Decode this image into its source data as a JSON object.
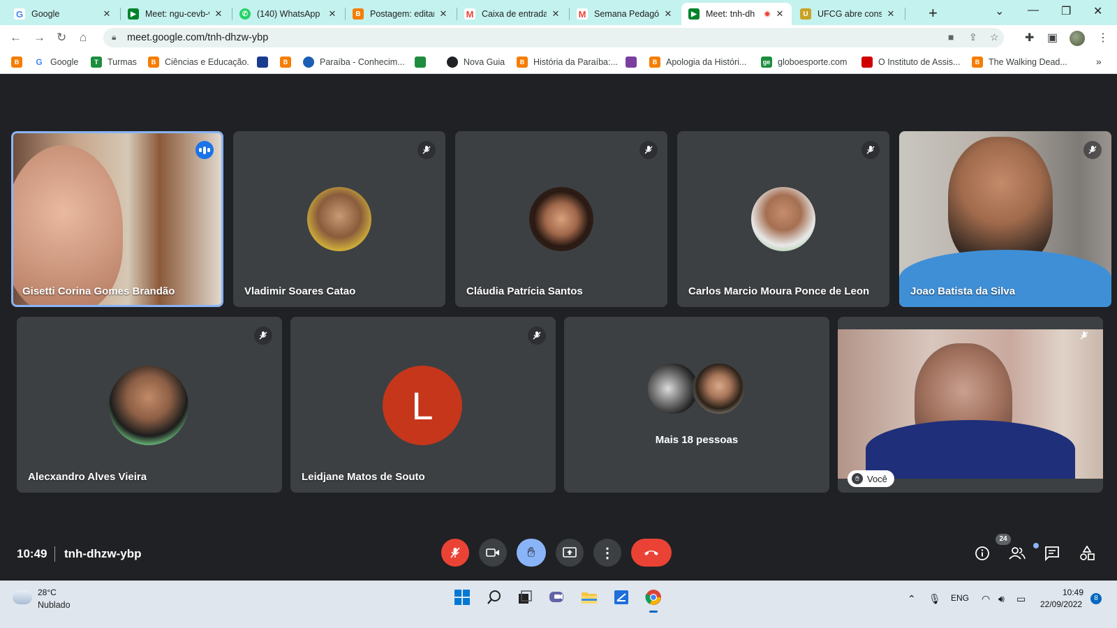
{
  "browser": {
    "tabs": [
      {
        "title": "Google",
        "favicon": "google-icon",
        "color": "#4285f4",
        "glyph": "G"
      },
      {
        "title": "Meet: ngu-cevb-v",
        "favicon": "meet-icon",
        "color": "#00832d",
        "glyph": "▶"
      },
      {
        "title": "(140) WhatsApp",
        "favicon": "whatsapp-icon",
        "color": "#25d366",
        "glyph": "✆"
      },
      {
        "title": "Postagem: editar",
        "favicon": "blogger-icon",
        "color": "#f57d00",
        "glyph": "B"
      },
      {
        "title": "Caixa de entrada",
        "favicon": "gmail-icon",
        "color": "#ea4335",
        "glyph": "M"
      },
      {
        "title": "Semana Pedagóg",
        "favicon": "gmail-icon",
        "color": "#ea4335",
        "glyph": "M"
      },
      {
        "title": "Meet: tnh-dh",
        "favicon": "meet-icon",
        "color": "#00832d",
        "glyph": "▶",
        "active": true,
        "recording": true
      },
      {
        "title": "UFCG abre consu",
        "favicon": "ufcg-icon",
        "color": "#c9a227",
        "glyph": "U"
      }
    ],
    "new_tab": "+",
    "url": "meet.google.com/tnh-dhzw-ybp",
    "bookmarks": [
      {
        "label": "",
        "icon": "blogger-icon",
        "color": "#f57d00",
        "glyph": "B"
      },
      {
        "label": "Google",
        "icon": "google-icon",
        "color": "#4285f4",
        "glyph": "G"
      },
      {
        "label": "Turmas",
        "icon": "classroom-icon",
        "color": "#1e8e3e",
        "glyph": "T"
      },
      {
        "label": "Ciências e Educação.",
        "icon": "blogger-icon",
        "color": "#f57d00",
        "glyph": "B"
      },
      {
        "label": "",
        "icon": "site-icon",
        "color": "#1a3c8f",
        "glyph": "▬"
      },
      {
        "label": "",
        "icon": "blogger-icon",
        "color": "#f57d00",
        "glyph": "B"
      },
      {
        "label": "Paraíba - Conhecim...",
        "icon": "brain-icon",
        "color": "#1a5fb4",
        "glyph": "◉"
      },
      {
        "label": "",
        "icon": "flag-icon",
        "color": "#1e8e3e",
        "glyph": "◆"
      },
      {
        "label": "Nova Guia",
        "icon": "globe-icon",
        "color": "#202124",
        "glyph": "◍"
      },
      {
        "label": "História da Paraíba:...",
        "icon": "blogger-icon",
        "color": "#f57d00",
        "glyph": "B"
      },
      {
        "label": "",
        "icon": "site-icon",
        "color": "#7b3fa0",
        "glyph": "▦"
      },
      {
        "label": "Apologia da Históri...",
        "icon": "blogger-icon",
        "color": "#f57d00",
        "glyph": "B"
      },
      {
        "label": "globoesporte.com",
        "icon": "ge-icon",
        "color": "#1e8e3e",
        "glyph": "ge"
      },
      {
        "label": "O Instituto de Assis...",
        "icon": "flag-icon",
        "color": "#d10000",
        "glyph": "■"
      },
      {
        "label": "The Walking Dead...",
        "icon": "blogger-icon",
        "color": "#f57d00",
        "glyph": "B"
      }
    ],
    "more_bookmarks": "»"
  },
  "meet": {
    "participants": [
      {
        "name": "Gisetti Corina Gomes Brandão",
        "kind": "video",
        "speaking": true
      },
      {
        "name": "Vladimir Soares Catao",
        "kind": "avatar",
        "muted": true
      },
      {
        "name": "Cláudia Patrícia Santos",
        "kind": "avatar",
        "muted": true
      },
      {
        "name": "Carlos Marcio Moura Ponce de Leon",
        "kind": "avatar",
        "muted": true
      },
      {
        "name": "Joao Batista da Silva",
        "kind": "video",
        "muted": true
      },
      {
        "name": "Alecxandro Alves Vieira",
        "kind": "avatar",
        "muted": true
      },
      {
        "name": "Leidjane Matos de Souto",
        "kind": "letter",
        "letter": "L",
        "muted": true
      },
      {
        "name": "",
        "kind": "overflow",
        "label": "Mais 18 pessoas"
      },
      {
        "name": "",
        "kind": "self",
        "label": "Você",
        "muted": true
      }
    ],
    "time": "10:49",
    "meeting_code": "tnh-dhzw-ybp",
    "people_count": "24",
    "colors": {
      "end_call": "#ea4335",
      "mic_off": "#ea4335",
      "hand_raised": "#8ab4f8",
      "control": "#3c4043",
      "speaking": "#1a73e8"
    }
  },
  "taskbar": {
    "weather_temp": "28°C",
    "weather_desc": "Nublado",
    "language": "ENG",
    "clock_time": "10:49",
    "clock_date": "22/09/2022",
    "notifications": "8",
    "apps": [
      "windows-start-icon",
      "search-icon",
      "task-view-icon",
      "teams-chat-icon",
      "file-explorer-icon",
      "microsoft-store-icon",
      "chrome-icon"
    ]
  }
}
